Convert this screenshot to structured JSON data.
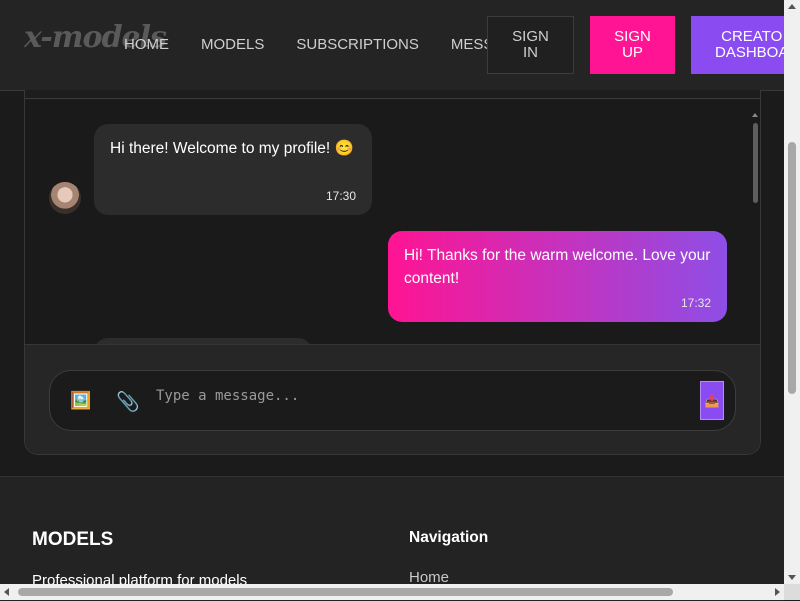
{
  "header": {
    "logo_text": "x-models",
    "nav": [
      "HOME",
      "MODELS",
      "SUBSCRIPTIONS",
      "MESSAGES"
    ],
    "sign_in": "SIGN\nIN",
    "sign_up": "SIGN\nUP",
    "creator": "CREATO\nDASHBOA"
  },
  "chat": {
    "messages": [
      {
        "direction": "incoming",
        "text": "Hi there! Welcome to my profile! 😊",
        "time": "17:30"
      },
      {
        "direction": "outgoing",
        "text": "Hi! Thanks for the warm welcome. Love your content!",
        "time": "17:32"
      }
    ],
    "input": {
      "placeholder": "Type a message...",
      "value": "",
      "image_icon": "🖼️",
      "attach_icon": "📎",
      "send_icon": "📤"
    }
  },
  "footer": {
    "brand_title": "MODELS",
    "brand_desc": "Professional platform for models",
    "nav_title": "Navigation",
    "nav_links": [
      "Home"
    ]
  },
  "colors": {
    "accent_pink": "#ff1493",
    "accent_purple": "#8a4cf0",
    "background": "#1b1b1b"
  }
}
